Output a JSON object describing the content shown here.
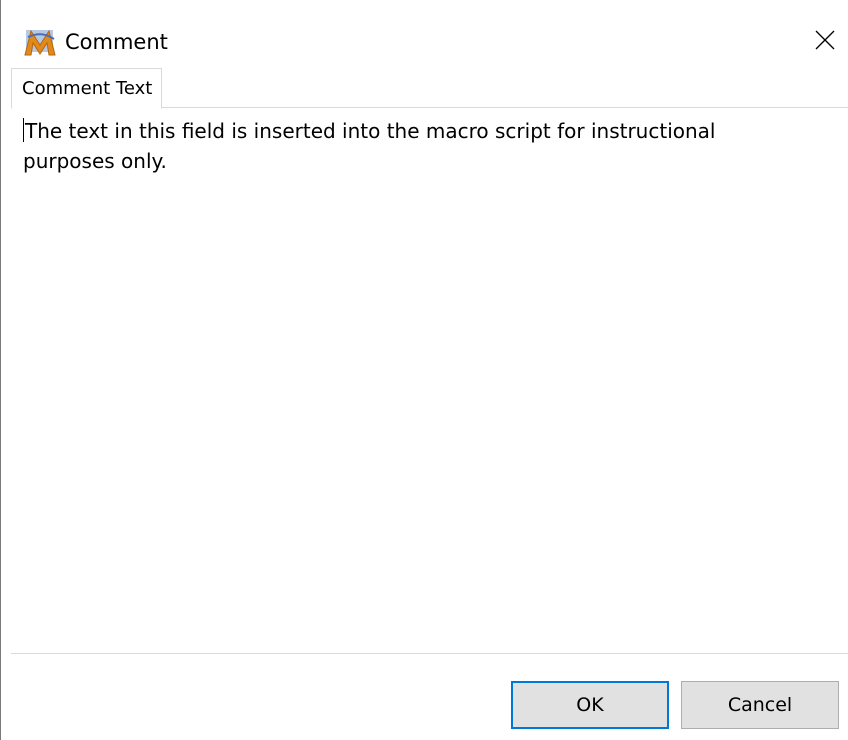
{
  "window": {
    "title": "Comment",
    "icon": "macro-m-icon",
    "close_icon": "close-icon"
  },
  "tabs": [
    {
      "label": "Comment Text",
      "active": true
    }
  ],
  "comment": {
    "text": "The text in this field is inserted into the macro script for instructional\npurposes only."
  },
  "buttons": {
    "ok_label": "OK",
    "cancel_label": "Cancel"
  },
  "colors": {
    "focus_border": "#0078d7",
    "button_face": "#e1e1e1",
    "icon_orange": "#e08a1e",
    "icon_blue": "#6f8fc9"
  }
}
